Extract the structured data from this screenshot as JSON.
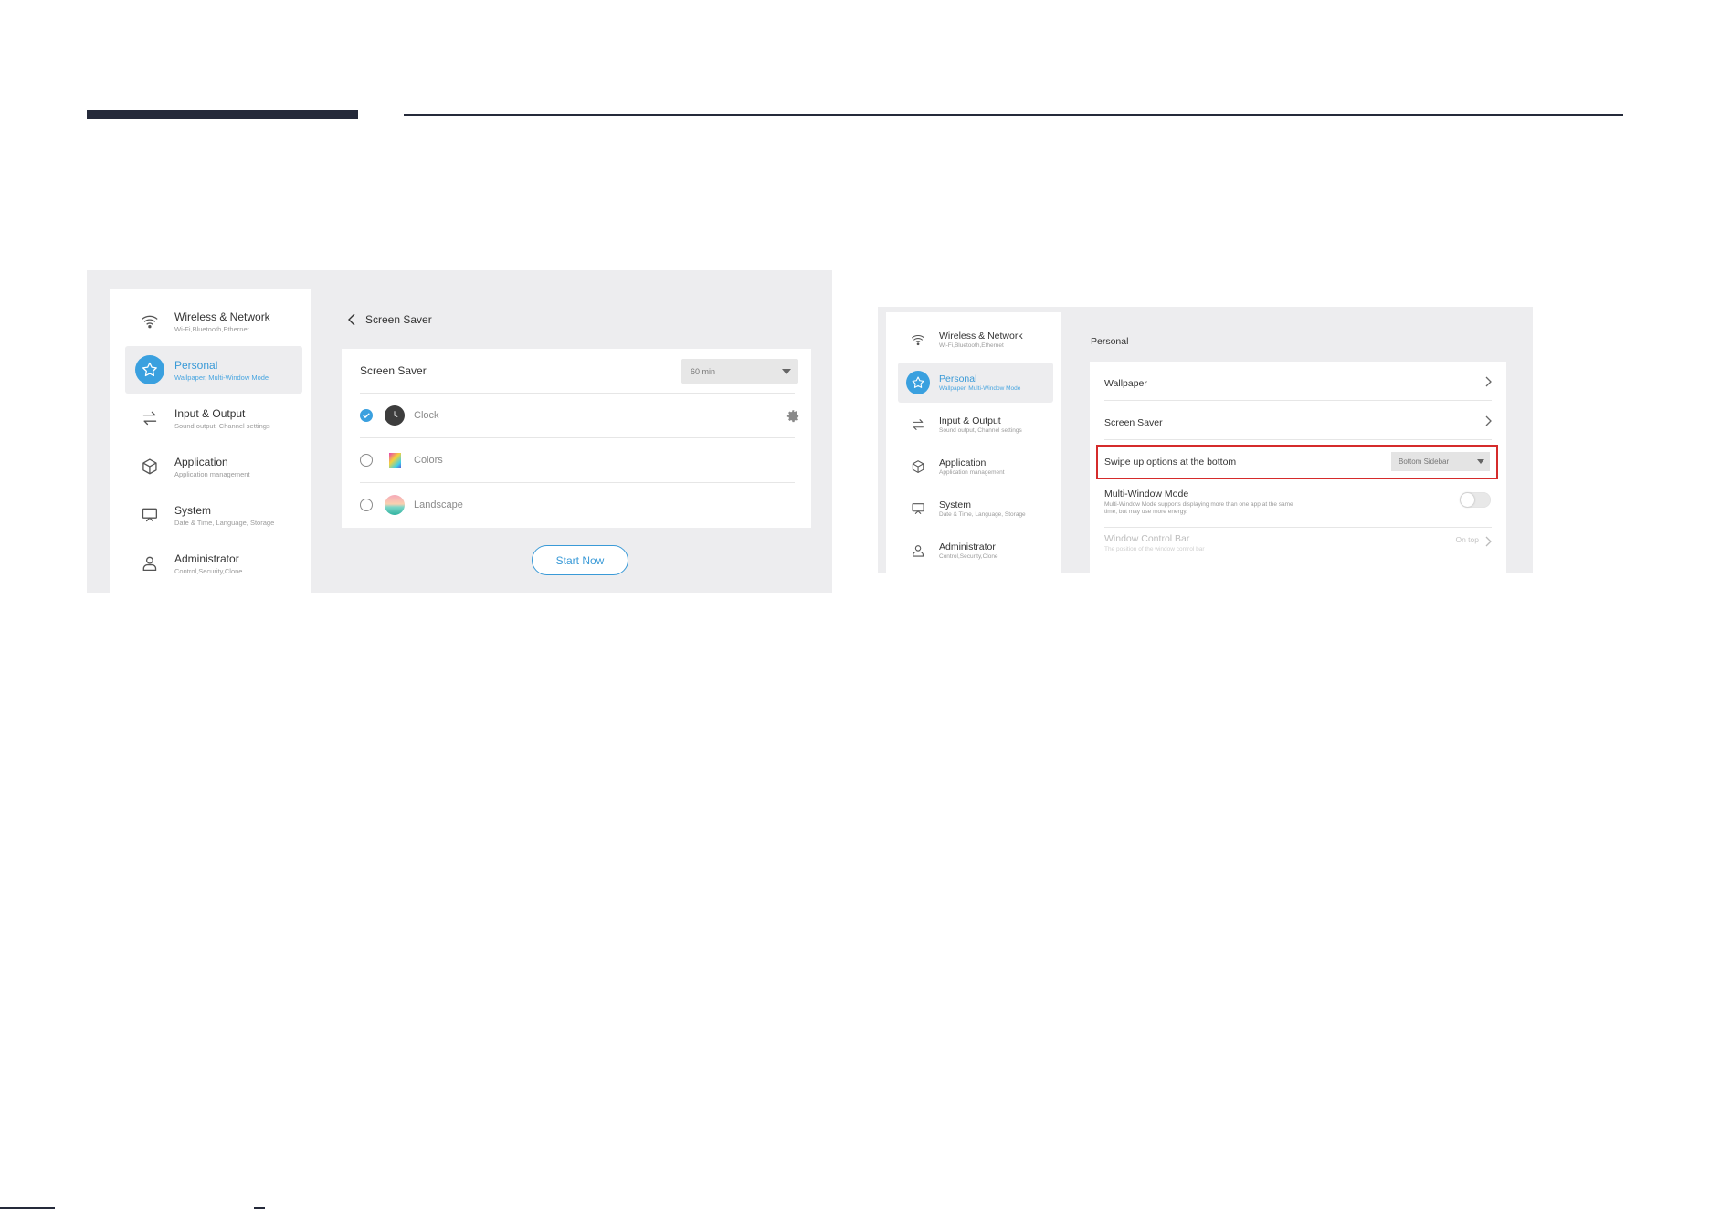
{
  "screen1": {
    "sidebar": [
      {
        "label": "Wireless & Network",
        "sub": "Wi-Fi,Bluetooth,Ethernet",
        "icon": "wifi-icon"
      },
      {
        "label": "Personal",
        "sub": "Wallpaper, Multi-Window Mode",
        "icon": "star-icon",
        "active": true
      },
      {
        "label": "Input & Output",
        "sub": "Sound output, Channel settings",
        "icon": "swap-arrows-icon"
      },
      {
        "label": "Application",
        "sub": "Application management",
        "icon": "cube-icon"
      },
      {
        "label": "System",
        "sub": "Date & Time, Language, Storage",
        "icon": "monitor-icon"
      },
      {
        "label": "Administrator",
        "sub": "Control,Security,Clone",
        "icon": "person-icon"
      }
    ],
    "back_title": "Screen Saver",
    "screen_saver_label": "Screen Saver",
    "screen_saver_value": "60 min",
    "options": [
      {
        "label": "Clock",
        "selected": true
      },
      {
        "label": "Colors",
        "selected": false
      },
      {
        "label": "Landscape",
        "selected": false
      }
    ],
    "start_button": "Start Now"
  },
  "screen2": {
    "sidebar": [
      {
        "label": "Wireless & Network",
        "sub": "Wi-Fi,Bluetooth,Ethernet",
        "icon": "wifi-icon"
      },
      {
        "label": "Personal",
        "sub": "Wallpaper, Multi-Window Mode",
        "icon": "star-icon",
        "active": true
      },
      {
        "label": "Input & Output",
        "sub": "Sound output, Channel settings",
        "icon": "swap-arrows-icon"
      },
      {
        "label": "Application",
        "sub": "Application management",
        "icon": "cube-icon"
      },
      {
        "label": "System",
        "sub": "Date & Time, Language, Storage",
        "icon": "monitor-icon"
      },
      {
        "label": "Administrator",
        "sub": "Control,Security,Clone",
        "icon": "person-icon"
      }
    ],
    "panel_title": "Personal",
    "wallpaper": "Wallpaper",
    "screen_saver": "Screen Saver",
    "swipe_label": "Swipe up options at the bottom",
    "swipe_value": "Bottom Sidebar",
    "multi_window_label": "Multi-Window Mode",
    "multi_window_desc": "Multi-Window Mode supports displaying more than one app at the same time, but may use more energy.",
    "window_bar_label": "Window Control Bar",
    "window_bar_desc": "The position of the window control bar",
    "window_bar_value": "On top"
  },
  "colors": {
    "accent": "#3aa0df",
    "highlight": "#d52b2b",
    "header": "#252a3a"
  }
}
